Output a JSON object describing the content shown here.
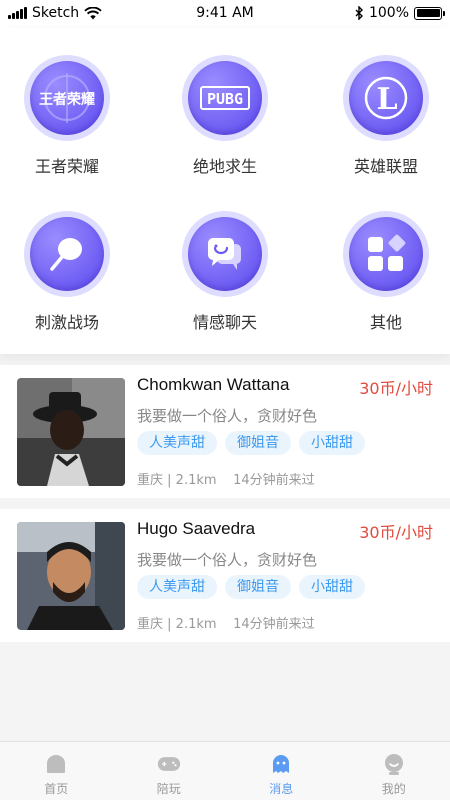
{
  "status_bar": {
    "carrier": "Sketch",
    "time": "9:41 AM",
    "battery": "100%"
  },
  "categories": [
    {
      "label": "王者荣耀",
      "icon": "wangzhe-logo-icon",
      "logo_text": "王者荣耀"
    },
    {
      "label": "绝地求生",
      "icon": "pubg-logo-icon",
      "logo_text": "PUBG"
    },
    {
      "label": "英雄联盟",
      "icon": "lol-logo-icon",
      "logo_text": "L"
    },
    {
      "label": "刺激战场",
      "icon": "frying-pan-icon"
    },
    {
      "label": "情感聊天",
      "icon": "chat-bubbles-icon"
    },
    {
      "label": "其他",
      "icon": "more-grid-icon"
    }
  ],
  "companions": [
    {
      "name": "Chomkwan Wattana",
      "price": "30币/小时",
      "bio": "我要做一个俗人，贪财好色",
      "tags": [
        "人美声甜",
        "御姐音",
        "小甜甜"
      ],
      "location": "重庆",
      "distance": "2.1km",
      "last_seen": "14分钟前来过"
    },
    {
      "name": "Hugo Saavedra",
      "price": "30币/小时",
      "bio": "我要做一个俗人，贪财好色",
      "tags": [
        "人美声甜",
        "御姐音",
        "小甜甜"
      ],
      "location": "重庆",
      "distance": "2.1km",
      "last_seen": "14分钟前来过"
    }
  ],
  "tabbar": {
    "active": "消息",
    "items": [
      {
        "label": "首页",
        "icon": "home-icon"
      },
      {
        "label": "陪玩",
        "icon": "gamepad-icon"
      },
      {
        "label": "消息",
        "icon": "message-icon"
      },
      {
        "label": "我的",
        "icon": "profile-icon"
      }
    ]
  },
  "colors": {
    "accent_purple": "#6b5af2",
    "price_red": "#e14b3d",
    "tag_blue": "#3a9af0",
    "active_tab": "#5b9cf2"
  }
}
